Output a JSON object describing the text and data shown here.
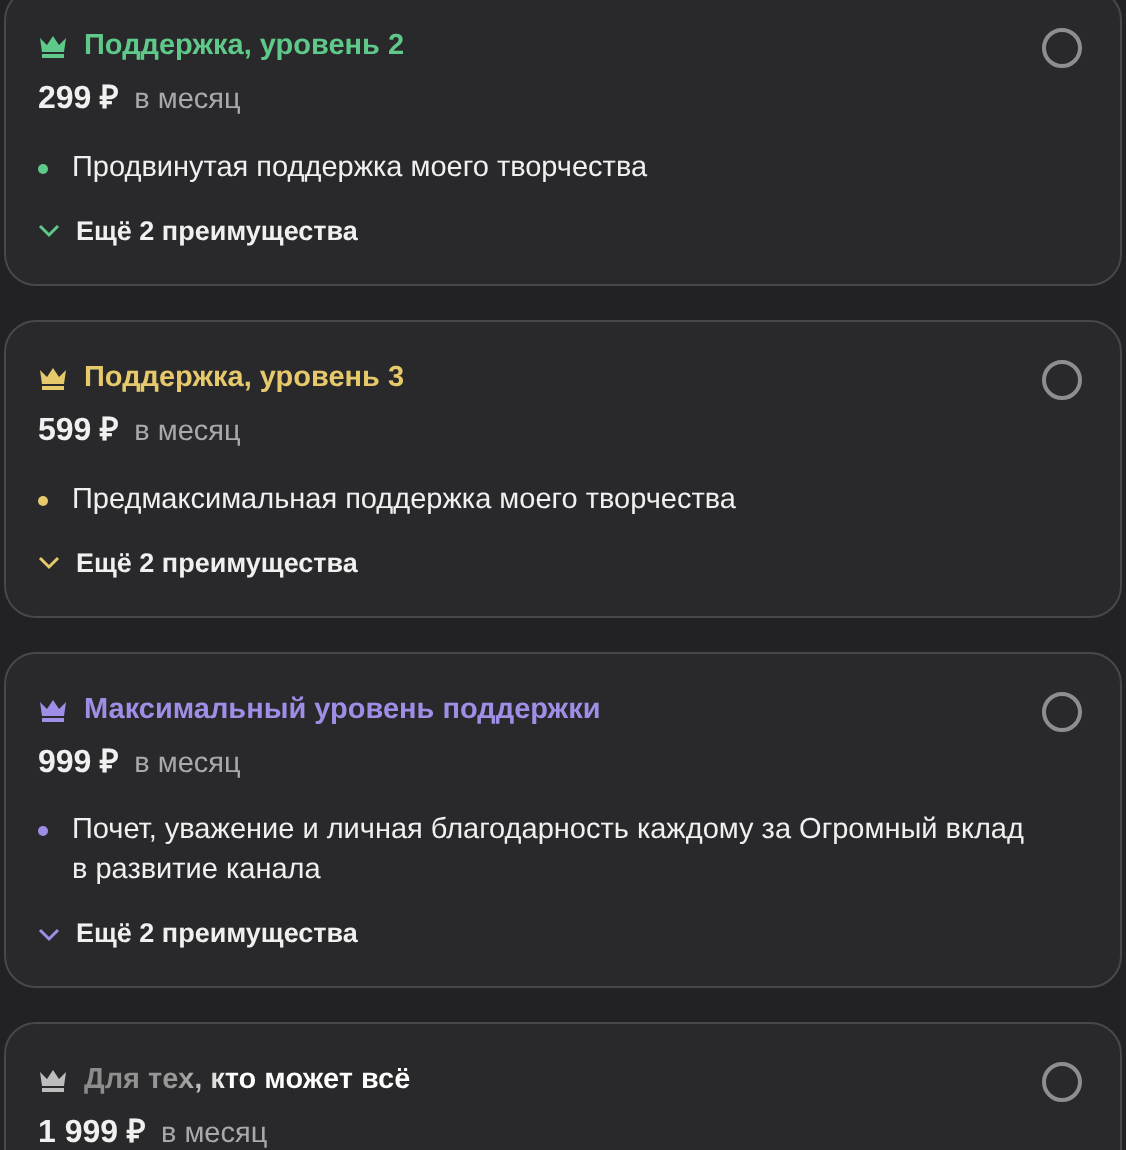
{
  "tiers": [
    {
      "title": "Поддержка, уровень 2",
      "kind": "solid",
      "color": "#5fc98a",
      "price": "299 ₽",
      "period": "в месяц",
      "selected": false,
      "benefits": [
        "Продвинутая поддержка моего творчества"
      ],
      "more": "Ещё 2 преимущества"
    },
    {
      "title": "Поддержка, уровень 3",
      "kind": "solid",
      "color": "#e6c96a",
      "price": "599 ₽",
      "period": "в месяц",
      "selected": false,
      "benefits": [
        "Предмаксимальная поддержка моего творчества"
      ],
      "more": "Ещё 2 преимущества"
    },
    {
      "title": "Максимальный уровень поддержки",
      "kind": "solid",
      "color": "#a08ee6",
      "price": "999 ₽",
      "period": "в месяц",
      "selected": false,
      "benefits": [
        "Почет, уважение и личная благодарность каждому за Огромный вклад в развитие канала"
      ],
      "more": "Ещё 2 преимущества"
    },
    {
      "title": "Для тех, кто может всё",
      "kind": "gradient",
      "color": "#bdbdbd",
      "price": "1 999 ₽",
      "period": "в месяц",
      "selected": false
    }
  ]
}
